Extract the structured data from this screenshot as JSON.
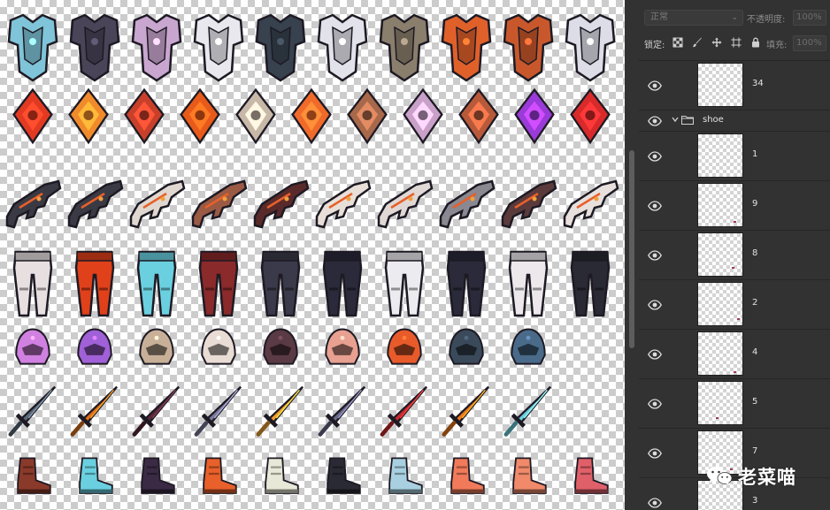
{
  "panel": {
    "blend_mode": "正常",
    "opacity_label": "不透明度:",
    "opacity_value": "100%",
    "lock_label": "锁定:",
    "fill_label": "填充:",
    "fill_value": "100%"
  },
  "layers": [
    {
      "name": "34",
      "kind": "layer"
    },
    {
      "name": "shoe",
      "kind": "group"
    },
    {
      "name": "1",
      "kind": "layer"
    },
    {
      "name": "9",
      "kind": "layer"
    },
    {
      "name": "8",
      "kind": "layer"
    },
    {
      "name": "2",
      "kind": "layer"
    },
    {
      "name": "4",
      "kind": "layer"
    },
    {
      "name": "5",
      "kind": "layer"
    },
    {
      "name": "7",
      "kind": "layer"
    },
    {
      "name": "3",
      "kind": "layer"
    }
  ],
  "watermark": {
    "text": "老菜喵",
    "icon": "wechat-icon"
  },
  "icons": {
    "eye": "eye-icon",
    "folder": "folder-icon",
    "chevron": "chevron-down-icon",
    "lock_transparent": "lock-transparent-pixels-icon",
    "lock_paint": "brush-icon",
    "lock_position": "move-icon",
    "lock_artboard": "artboard-icon",
    "lock_all": "lock-icon"
  },
  "sprite_rows": [
    {
      "category": "armor",
      "colors": [
        "#7fc4d8",
        "#4a4458",
        "#c9a6cf",
        "#e8e8ee",
        "#37424e",
        "#e2e2ea",
        "#8a7e6c",
        "#e0602a",
        "#c8582c",
        "#dcdde6"
      ]
    },
    {
      "category": "gem",
      "colors": [
        "#e23a22",
        "#f08a2a",
        "#c8402a",
        "#e85a1a",
        "#c8b8a8",
        "#f06a2a",
        "#a8684a",
        "#c8a0c8",
        "#b85a3a",
        "#9a3ad8",
        "#d82a2a"
      ]
    },
    {
      "category": "gun",
      "colors": [
        "#3a3a44",
        "#3a3a44",
        "#e0d8d0",
        "#9a5a44",
        "#5a2a2a",
        "#e8e0d8",
        "#e0d8d4",
        "#8a8890",
        "#5a3a3a",
        "#e8e0dc"
      ]
    },
    {
      "category": "pants",
      "colors": [
        "#e8e0e0",
        "#e0401a",
        "#6ad0e0",
        "#8a2a2a",
        "#3a3a4a",
        "#2a2a3a",
        "#ececf0",
        "#2a2a3a",
        "#ece8ec",
        "#2a2a34"
      ]
    },
    {
      "category": "helmet",
      "colors": [
        "#d080e0",
        "#a060d8",
        "#c8b098",
        "#e8dcd4",
        "#5a3a44",
        "#e8a090",
        "#e85a2a",
        "#3a4a5a",
        "#4a6a8a"
      ]
    },
    {
      "category": "sword",
      "colors": [
        "#5a6a7a",
        "#e0701a",
        "#5a2a3a",
        "#7a7a9a",
        "#f0a030",
        "#6a6a8a",
        "#c82a2a",
        "#f07a1a",
        "#6ad0e0"
      ]
    },
    {
      "category": "shoe",
      "colors": [
        "#8a3a2a",
        "#6ad0e0",
        "#3a2a44",
        "#e8602a",
        "#e8e8d8",
        "#2a2a34",
        "#a8d0e0",
        "#f07a5a",
        "#f08a6a",
        "#e0606a"
      ]
    }
  ]
}
